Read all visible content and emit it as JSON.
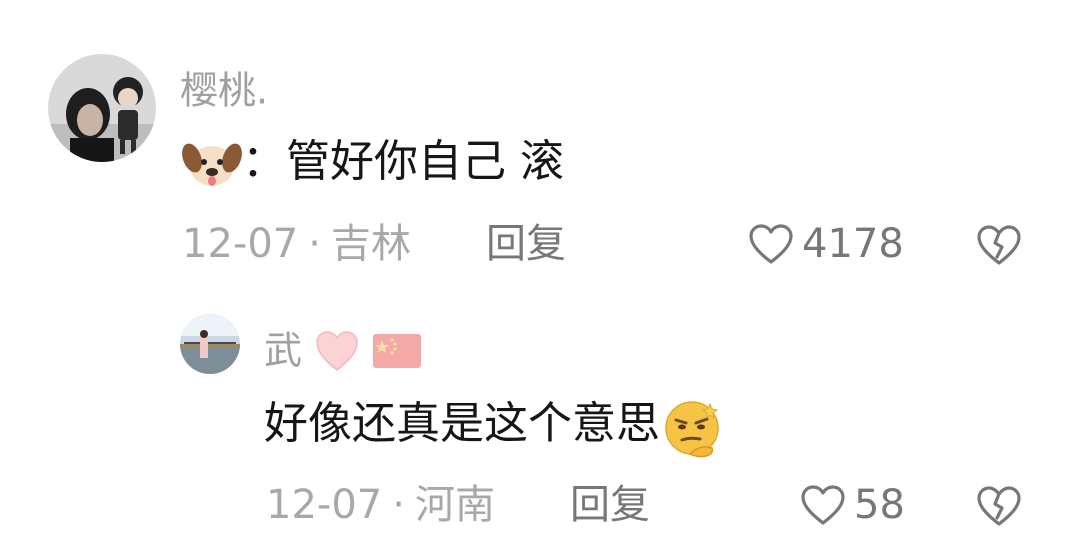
{
  "colors": {
    "username": "#a0a0a0",
    "content": "#161616",
    "meta": "#a8a8a8",
    "action": "#777777"
  },
  "comments": [
    {
      "username": "樱桃.",
      "content_prefix_icon": "dog-face-emoji-icon",
      "content": "：管好你自己 滚",
      "date": "12-07",
      "location": "吉林",
      "reply_label": "回复",
      "like_count": "4178"
    },
    {
      "username": "武",
      "username_icons": [
        "pink-heart-emoji-icon",
        "china-flag-emoji-icon"
      ],
      "content": "好像还真是这个意思",
      "content_suffix_icon": "thinking-smirk-emoji-icon",
      "date": "12-07",
      "location": "河南",
      "reply_label": "回复",
      "like_count": "58"
    }
  ],
  "meta_separator": "·"
}
